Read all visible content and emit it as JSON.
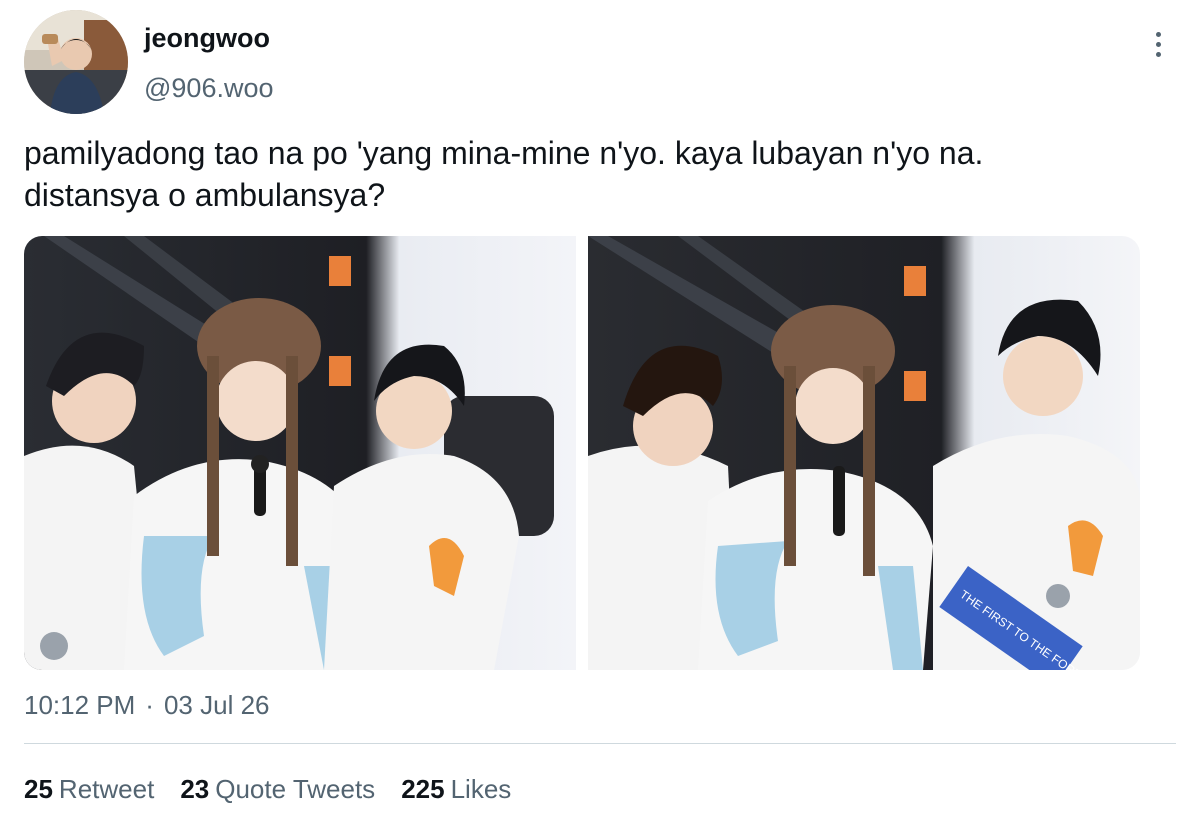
{
  "author": {
    "display_name": "jeongwoo",
    "handle": "@906.woo",
    "avatar_icon": "profile-photo"
  },
  "more_icon": "more-vertical-icon",
  "tweet": {
    "text": "pamilyadong tao na po 'yang mina-mine n'yo. kaya lubayan n'yo na.\ndistansya o ambulansya?"
  },
  "media": {
    "photo_count": 2,
    "photo_2_banner_text": "THE FIRST TO THE FOREVER"
  },
  "meta": {
    "time": "10:12 PM",
    "separator": "·",
    "date": "03 Jul 26"
  },
  "stats": {
    "retweets": {
      "count": "25",
      "label": "Retweet"
    },
    "quotes": {
      "count": "23",
      "label": "Quote Tweets"
    },
    "likes": {
      "count": "225",
      "label": "Likes"
    }
  },
  "colors": {
    "text_primary": "#0f1419",
    "text_secondary": "#536471",
    "divider": "#cfd9de",
    "background": "#ffffff"
  }
}
